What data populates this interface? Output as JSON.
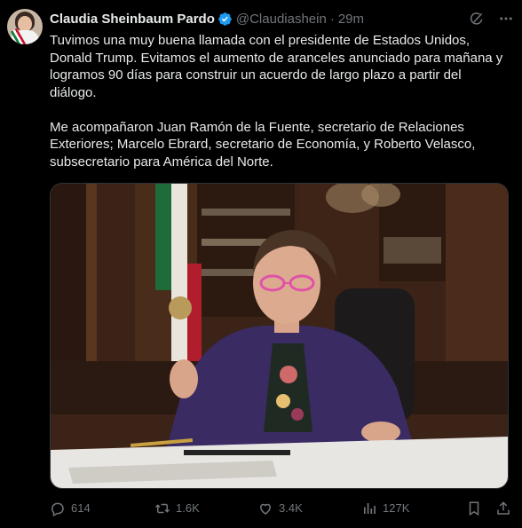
{
  "author": {
    "display_name": "Claudia Sheinbaum Pardo",
    "handle": "@Claudiashein",
    "separator": "·",
    "time": "29m"
  },
  "post": {
    "paragraph_1": "Tuvimos una muy buena llamada con el presidente de Estados Unidos, Donald Trump. Evitamos el aumento de aranceles anunciado para mañana y logramos 90 días para construir un acuerdo de largo plazo a partir del diálogo.",
    "paragraph_2": "Me acompañaron Juan Ramón de la Fuente, secretario de Relaciones Exteriores; Marcelo Ebrard, secretario de Economía, y Roberto Velasco, subsecretario para América del Norte."
  },
  "actions": {
    "replies": "614",
    "reposts": "1.6K",
    "likes": "3.4K",
    "views": "127K"
  },
  "colors": {
    "background": "#000000",
    "text": "#e7e9ea",
    "muted": "#71767b",
    "verified": "#1d9bf0"
  },
  "icons": [
    "verified-badge-icon",
    "grok-icon",
    "more-icon",
    "reply-icon",
    "repost-icon",
    "like-icon",
    "views-icon",
    "bookmark-icon",
    "share-icon"
  ]
}
